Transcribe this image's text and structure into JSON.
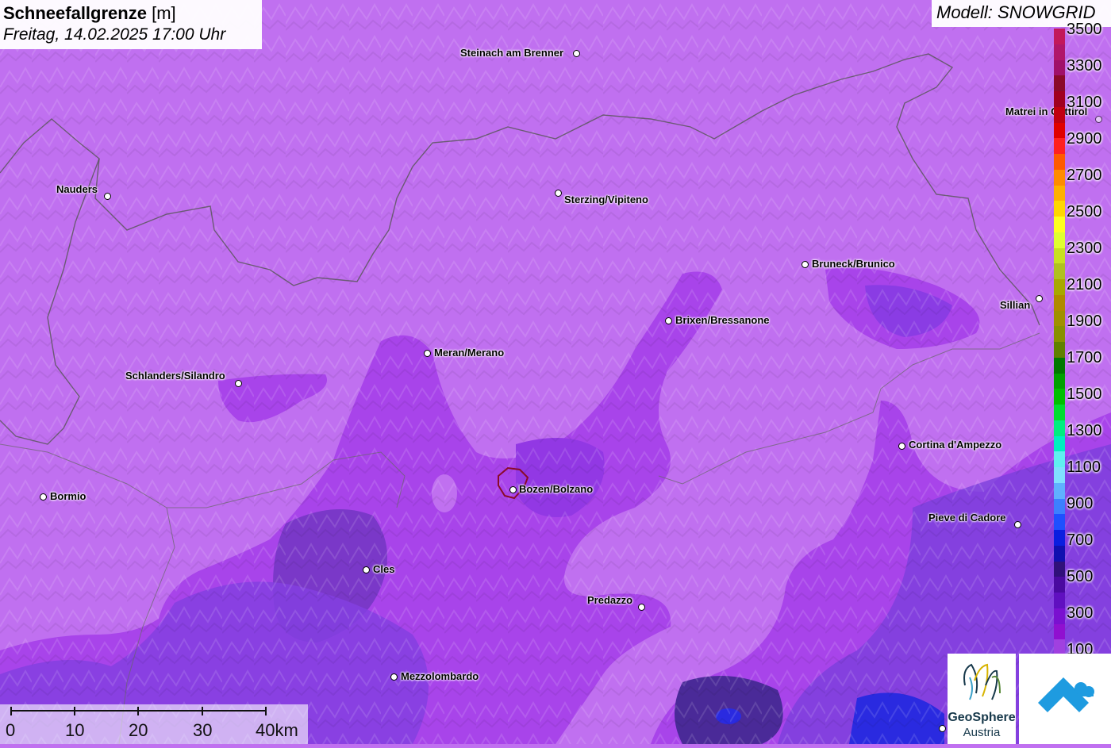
{
  "header": {
    "title": "Schneefallgrenze",
    "unit": "[m]",
    "datetime": "Freitag, 14.02.2025 17:00 Uhr"
  },
  "model": {
    "label": "Modell: SNOWGRID"
  },
  "cities": [
    {
      "name": "Steinach am Brenner"
    },
    {
      "name": "Nauders"
    },
    {
      "name": "Sterzing/Vipiteno"
    },
    {
      "name": "Matrei in Osttirol"
    },
    {
      "name": "Bruneck/Brunico"
    },
    {
      "name": "Sillian"
    },
    {
      "name": "Brixen/Bressanone"
    },
    {
      "name": "Meran/Merano"
    },
    {
      "name": "Schlanders/Silandro"
    },
    {
      "name": "Cortina d'Ampezzo"
    },
    {
      "name": "Bormio"
    },
    {
      "name": "Bozen/Bolzano"
    },
    {
      "name": "Pieve di Cadore"
    },
    {
      "name": "Cles"
    },
    {
      "name": "Predazzo"
    },
    {
      "name": "Mezzolombardo"
    }
  ],
  "legend": {
    "labels": [
      "3500",
      "3300",
      "3100",
      "2900",
      "2700",
      "2500",
      "2300",
      "2100",
      "1900",
      "1700",
      "1500",
      "1300",
      "1100",
      "900",
      "700",
      "500",
      "300",
      "100"
    ],
    "colors": [
      "#c2185b",
      "#b0166a",
      "#a0106a",
      "#8a0a2a",
      "#a00020",
      "#c00010",
      "#e00000",
      "#ff2020",
      "#ff5a00",
      "#ff8c00",
      "#ffb000",
      "#ffd700",
      "#ffff20",
      "#e0ff30",
      "#c8e020",
      "#b0c020",
      "#a8a800",
      "#b08a00",
      "#a09000",
      "#889000",
      "#608000",
      "#007800",
      "#00a000",
      "#00c000",
      "#00dd30",
      "#00ee80",
      "#00f0c0",
      "#60f0f0",
      "#80e0ff",
      "#60b0ff",
      "#3c80ff",
      "#1e50ff",
      "#0a1ee0",
      "#1010b0",
      "#30107a",
      "#4a0aa0",
      "#6010c0",
      "#7a10d0",
      "#9010d0",
      "#a040e0"
    ]
  },
  "scale": {
    "ticks": [
      "0",
      "10",
      "20",
      "30",
      "40km"
    ]
  },
  "logos": {
    "geosphere_line1": "GeoSphere",
    "geosphere_line2": "Austria"
  },
  "colors": {
    "base": "#c070f0",
    "medium": "#a040e0",
    "dark": "#8a38e0",
    "deep": "#6a30b8",
    "blue": "#3a3adf",
    "border": "#555555"
  }
}
